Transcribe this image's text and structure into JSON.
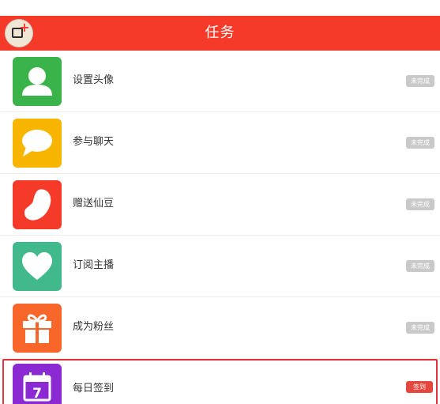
{
  "header": {
    "title": "任务"
  },
  "tasks": [
    {
      "label": "设置头像",
      "status": "未完成",
      "icon": "user-icon",
      "color": "#3bb34b"
    },
    {
      "label": "参与聊天",
      "status": "未完成",
      "icon": "chat-bubble-icon",
      "color": "#f7b500"
    },
    {
      "label": "赠送仙豆",
      "status": "未完成",
      "icon": "bean-icon",
      "color": "#f53a2a"
    },
    {
      "label": "订阅主播",
      "status": "未完成",
      "icon": "heart-icon",
      "color": "#41b98c"
    },
    {
      "label": "成为粉丝",
      "status": "未完成",
      "icon": "gift-icon",
      "color": "#f8662a"
    },
    {
      "label": "每日签到",
      "status": "签到",
      "icon": "calendar-icon",
      "color": "#8b2ad3",
      "calendar_day": "7"
    }
  ],
  "colors": {
    "header_bg": "#f53a2a",
    "badge_done": "#c9c9c9",
    "badge_action": "#e3473d",
    "highlight_border": "#e0353c"
  }
}
